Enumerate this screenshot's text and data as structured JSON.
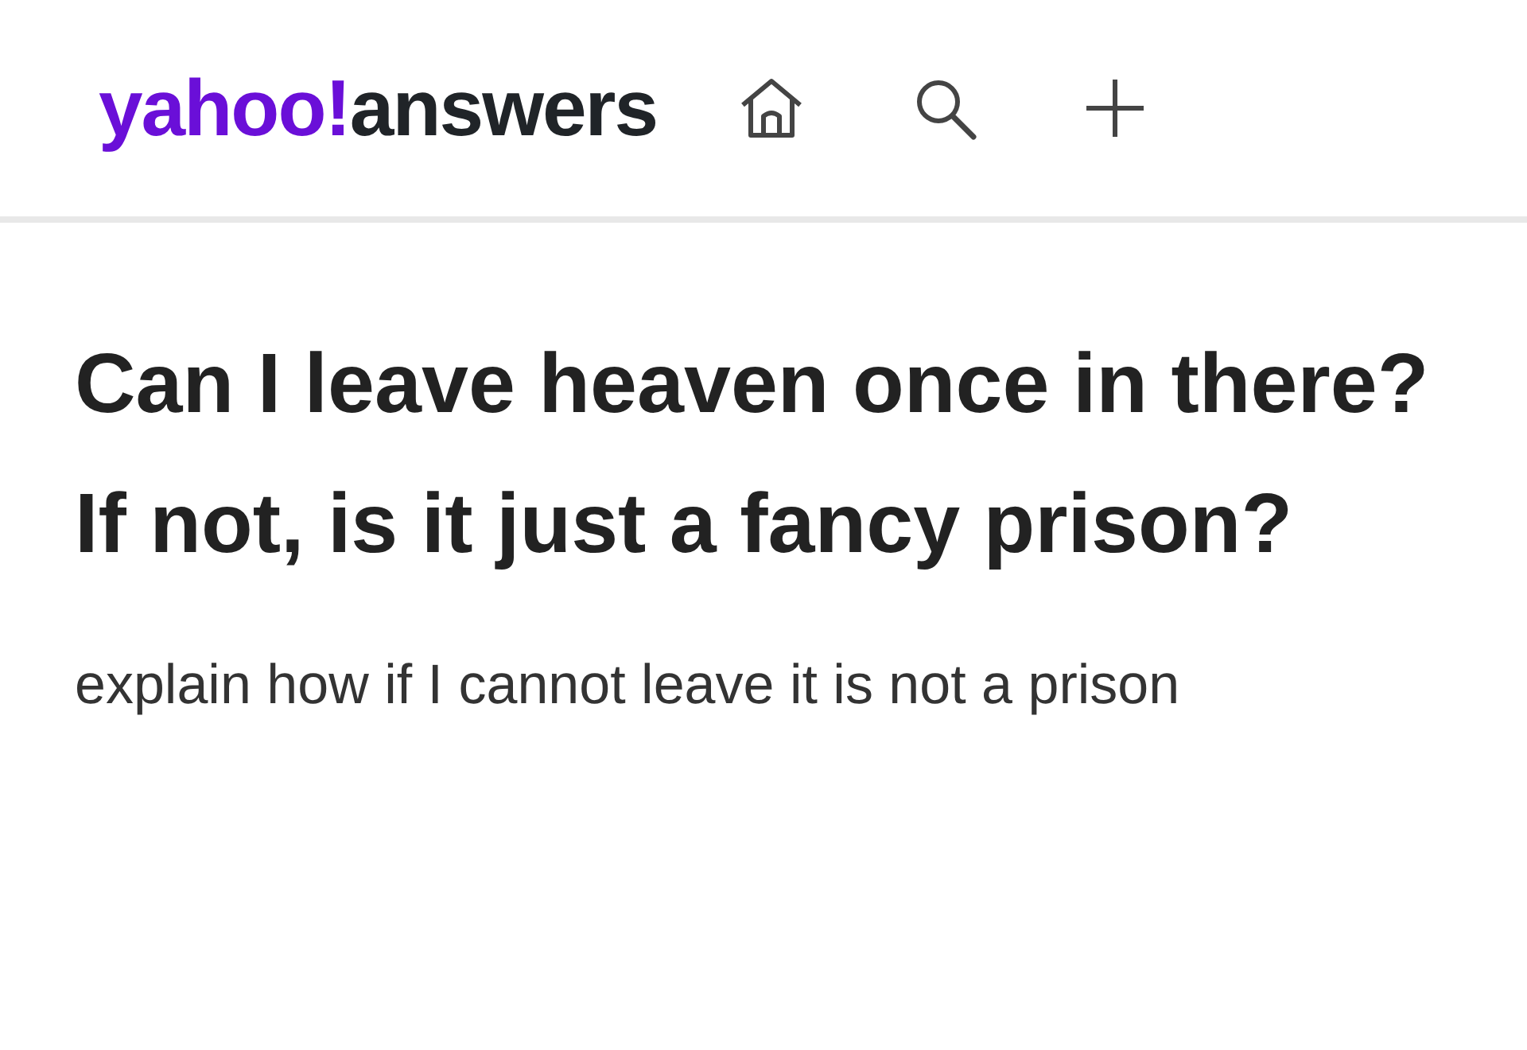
{
  "header": {
    "logo": {
      "brand": "yahoo!",
      "product": "answers"
    }
  },
  "question": {
    "title": "Can I leave heaven once in there? If not, is it just a fancy prison?",
    "details": "explain how if I cannot leave it is not a prison"
  }
}
